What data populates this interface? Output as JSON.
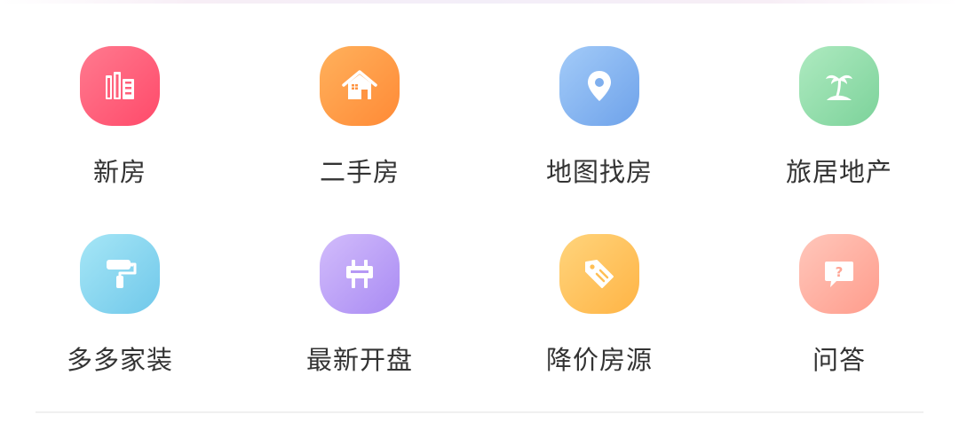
{
  "menu": {
    "items": [
      {
        "label": "新房",
        "icon": "building-icon",
        "color_from": "#ff6f86",
        "color_to": "#ff4d6c"
      },
      {
        "label": "二手房",
        "icon": "house-icon",
        "color_from": "#ffac55",
        "color_to": "#ff8c3a"
      },
      {
        "label": "地图找房",
        "icon": "map-pin-icon",
        "color_from": "#9cc5f7",
        "color_to": "#6fa4ec"
      },
      {
        "label": "旅居地产",
        "icon": "palm-tree-icon",
        "color_from": "#a6e6b9",
        "color_to": "#7fd49c"
      },
      {
        "label": "多多家装",
        "icon": "paint-roller-icon",
        "color_from": "#9ee3f5",
        "color_to": "#76cdec"
      },
      {
        "label": "最新开盘",
        "icon": "signboard-icon",
        "color_from": "#cdb5fb",
        "color_to": "#ad8ff5"
      },
      {
        "label": "降价房源",
        "icon": "price-tag-icon",
        "color_from": "#ffd27a",
        "color_to": "#ffb64a"
      },
      {
        "label": "问答",
        "icon": "question-bubble-icon",
        "color_from": "#ffc3b6",
        "color_to": "#ff9e8f"
      }
    ]
  }
}
